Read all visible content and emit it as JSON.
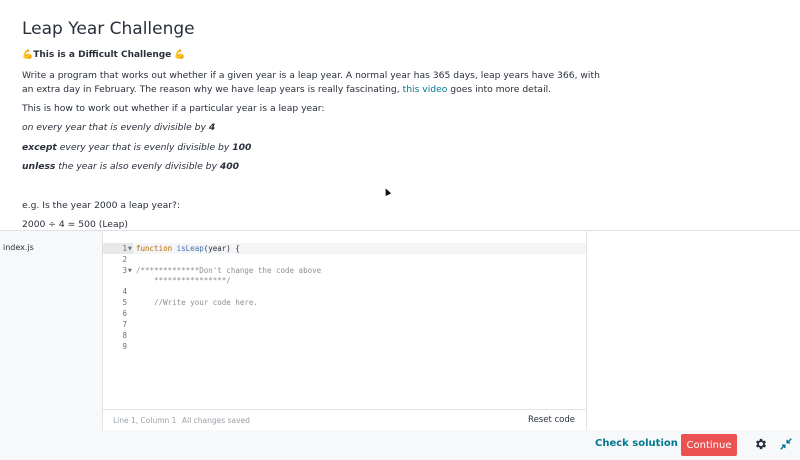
{
  "challenge": {
    "title": "Leap Year Challenge",
    "difficulty": "💪This is a Difficult Challenge 💪",
    "intro_before_link": "Write a program that works out whether if a given year is a leap year. A normal year has 365 days, leap years have 366, with an extra day in February. The reason why we have leap years is really fascinating, ",
    "link_text": "this video",
    "intro_after_link": " goes into more detail.",
    "how_to": "This is how to work out whether if a particular year is a leap year:",
    "rules": [
      {
        "bold_prefix": "",
        "text": "on every year that is evenly divisible by ",
        "bold_suffix": "4"
      },
      {
        "bold_prefix": "except",
        "text": " every year that is evenly divisible by ",
        "bold_suffix": "100"
      },
      {
        "bold_prefix": "unless",
        "text": " the year is also evenly divisible by ",
        "bold_suffix": "400"
      }
    ],
    "example_question": "e.g. Is the year 2000 a leap year?:",
    "example_calc": "2000 ÷ 4 = 500 (Leap)"
  },
  "editor": {
    "file_name": "index.js",
    "line_numbers": [
      "1",
      "2",
      "3",
      "4",
      "5",
      "6",
      "7",
      "8",
      "9"
    ],
    "code": {
      "line1_kw": "function",
      "line1_fn": "isLeap",
      "line1_rest": "(year) {",
      "line3a": "/*************Don't change the code above",
      "line3b": "    ****************/",
      "line5": "    //Write your code here."
    },
    "status_position": "Line 1, Column 1",
    "status_saved": "All changes saved",
    "reset_label": "Reset code"
  },
  "footer": {
    "check_label": "Check solution",
    "continue_label": "Continue",
    "settings_icon": "gear-icon",
    "exit_fullscreen_icon": "shrink-icon"
  },
  "colors": {
    "accent": "#007791",
    "continue_bg": "#ec5252"
  }
}
